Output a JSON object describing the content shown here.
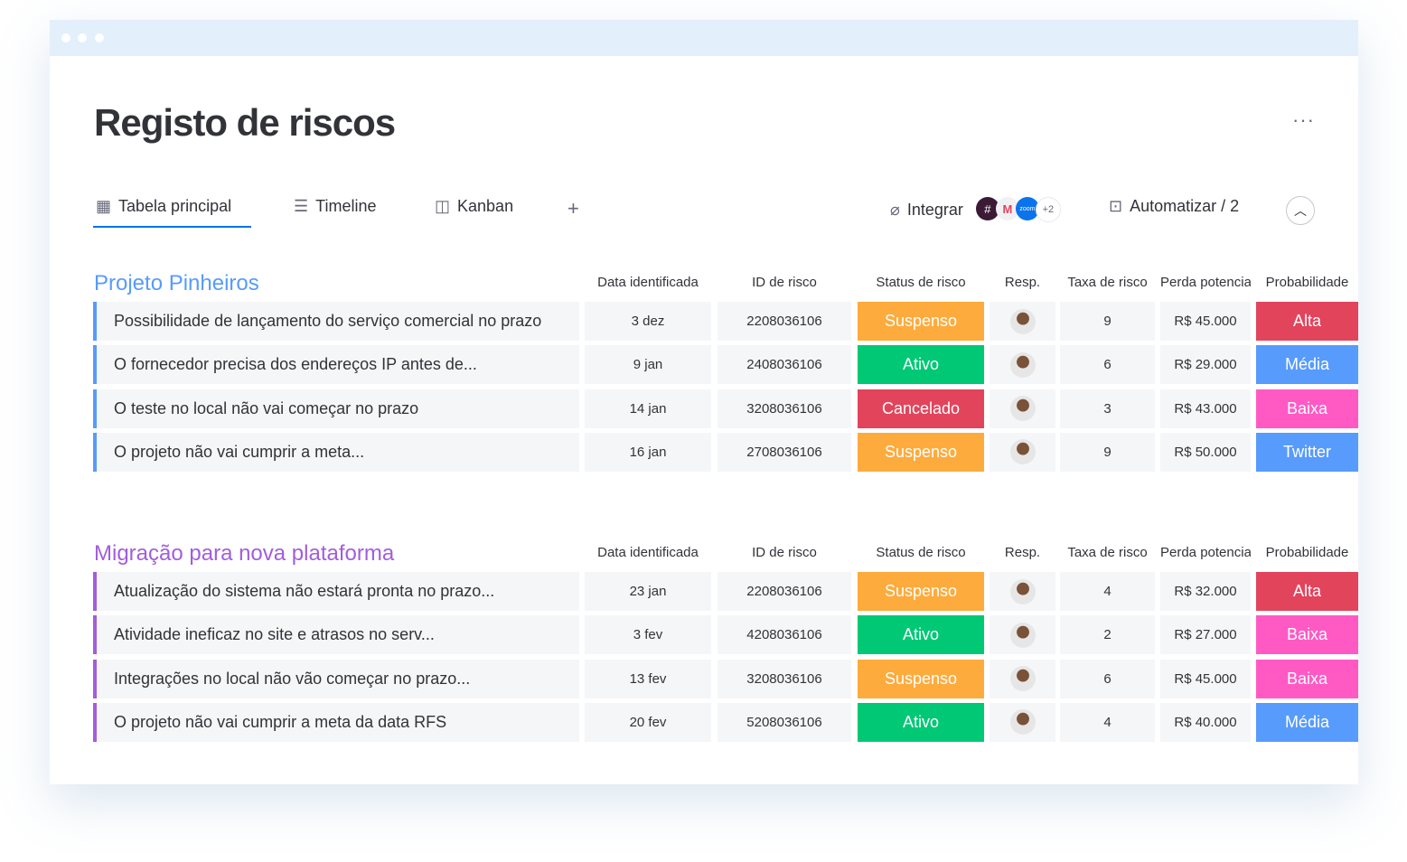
{
  "window": {
    "title": "Registo de riscos"
  },
  "toolbar": {
    "tabs": [
      {
        "label": "Tabela principal",
        "icon": "table-icon"
      },
      {
        "label": "Timeline",
        "icon": "timeline-icon"
      },
      {
        "label": "Kanban",
        "icon": "kanban-icon"
      }
    ],
    "add_label": "+",
    "integrate_label": "Integrar",
    "integrations_more": "+2",
    "automate_label": "Automatizar / 2",
    "more_label": "···"
  },
  "columns": [
    "Data identificada",
    "ID de risco",
    "Status de risco",
    "Resp.",
    "Taxa de risco",
    "Perda potencial",
    "Probabilidade"
  ],
  "colors": {
    "Suspenso": "#fdab3d",
    "Ativo": "#00c875",
    "Cancelado": "#e2445c",
    "Alta": "#e2445c",
    "Média": "#579bfc",
    "Baixa": "#ff5ac4",
    "Twitter": "#579bfc"
  },
  "groups": [
    {
      "title": "Projeto Pinheiros",
      "color": "#579bfc",
      "rows": [
        {
          "name": "Possibilidade de lançamento do serviço comercial no prazo",
          "date": "3 dez",
          "id": "2208036106",
          "status": "Suspenso",
          "rate": "9",
          "loss": "R$ 45.000",
          "prob": "Alta"
        },
        {
          "name": "O fornecedor precisa dos endereços IP antes de...",
          "date": "9 jan",
          "id": "2408036106",
          "status": "Ativo",
          "rate": "6",
          "loss": "R$ 29.000",
          "prob": "Média"
        },
        {
          "name": "O teste no local não vai começar no prazo",
          "date": "14 jan",
          "id": "3208036106",
          "status": "Cancelado",
          "rate": "3",
          "loss": "R$ 43.000",
          "prob": "Baixa"
        },
        {
          "name": "O projeto não vai cumprir a meta...",
          "date": "16 jan",
          "id": "2708036106",
          "status": "Suspenso",
          "rate": "9",
          "loss": "R$ 50.000",
          "prob": "Twitter"
        }
      ]
    },
    {
      "title": "Migração para nova plataforma",
      "color": "#a25ddc",
      "rows": [
        {
          "name": "Atualização do sistema não estará pronta no prazo...",
          "date": "23 jan",
          "id": "2208036106",
          "status": "Suspenso",
          "rate": "4",
          "loss": "R$ 32.000",
          "prob": "Alta"
        },
        {
          "name": "Atividade ineficaz no site e atrasos no serv...",
          "date": "3 fev",
          "id": "4208036106",
          "status": "Ativo",
          "rate": "2",
          "loss": "R$ 27.000",
          "prob": "Baixa"
        },
        {
          "name": "Integrações no local não vão começar no prazo...",
          "date": "13 fev",
          "id": "3208036106",
          "status": "Suspenso",
          "rate": "6",
          "loss": "R$ 45.000",
          "prob": "Baixa"
        },
        {
          "name": "O projeto não vai cumprir a meta da data RFS",
          "date": "20 fev",
          "id": "5208036106",
          "status": "Ativo",
          "rate": "4",
          "loss": "R$ 40.000",
          "prob": "Média"
        }
      ]
    }
  ]
}
